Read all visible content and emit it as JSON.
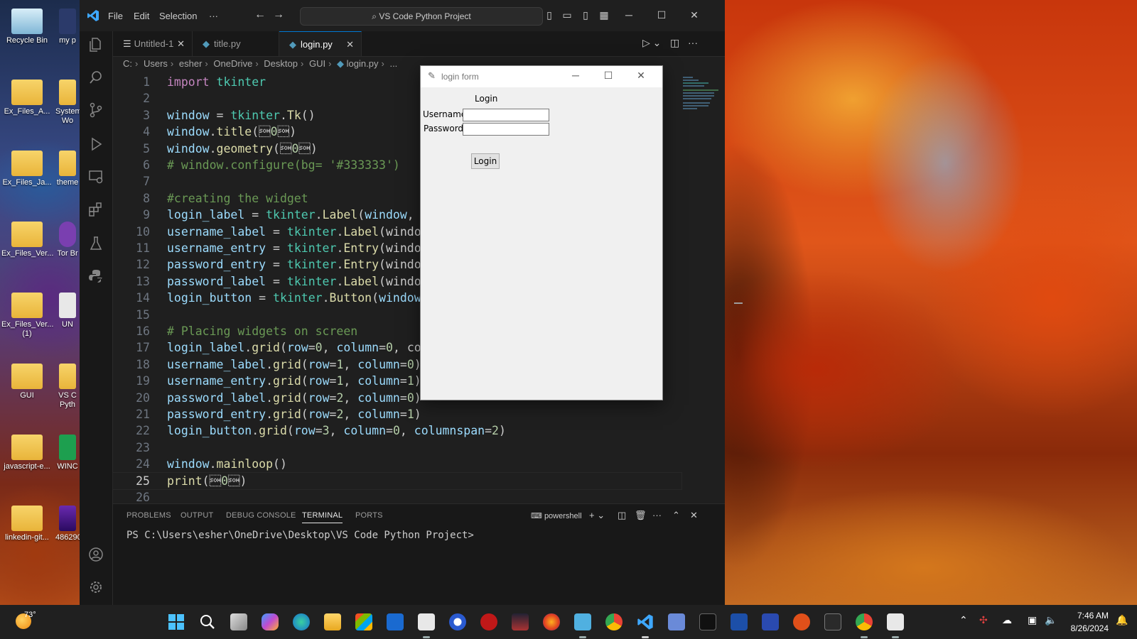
{
  "desktop": {
    "icons": [
      {
        "label": "Recycle Bin"
      },
      {
        "label": "my p"
      },
      {
        "label": "Ex_Files_A..."
      },
      {
        "label": "System Wo"
      },
      {
        "label": "Ex_Files_Ja..."
      },
      {
        "label": "theme"
      },
      {
        "label": "Ex_Files_Ver..."
      },
      {
        "label": "Tor Br"
      },
      {
        "label": "Ex_Files_Ver... (1)"
      },
      {
        "label": "UN"
      },
      {
        "label": "GUI"
      },
      {
        "label": "VS C Pyth"
      },
      {
        "label": "javascript-e..."
      },
      {
        "label": "WINC"
      },
      {
        "label": "linkedin-git..."
      },
      {
        "label": "486290"
      }
    ]
  },
  "vscode": {
    "menu": [
      "File",
      "Edit",
      "Selection",
      "···"
    ],
    "command_center": "VS Code Python Project",
    "tabs": [
      {
        "label": "Untitled-1"
      },
      {
        "label": "title.py"
      },
      {
        "label": "login.py"
      }
    ],
    "breadcrumb": [
      "C:",
      "Users",
      "esher",
      "OneDrive",
      "Desktop",
      "GUI",
      "login.py",
      "..."
    ],
    "current_line": 25,
    "code": [
      {
        "n": "1",
        "text": "import tkinter"
      },
      {
        "n": "2",
        "text": ""
      },
      {
        "n": "3",
        "text": "window = tkinter.Tk()"
      },
      {
        "n": "4",
        "text": "window.title(\"login form\")"
      },
      {
        "n": "5",
        "text": "window.geometry('340x440')"
      },
      {
        "n": "6",
        "text": "# window.configure(bg= '#333333')"
      },
      {
        "n": "7",
        "text": ""
      },
      {
        "n": "8",
        "text": "#creating the widget"
      },
      {
        "n": "9",
        "text": "login_label = tkinter.Label(window,"
      },
      {
        "n": "10",
        "text": "username_label = tkinter.Label(windo"
      },
      {
        "n": "11",
        "text": "username_entry = tkinter.Entry(windo"
      },
      {
        "n": "12",
        "text": "password_entry = tkinter.Entry(windo"
      },
      {
        "n": "13",
        "text": "password_label = tkinter.Label(windo"
      },
      {
        "n": "14",
        "text": "login_button = tkinter.Button(window"
      },
      {
        "n": "15",
        "text": ""
      },
      {
        "n": "16",
        "text": "# Placing widgets on screen"
      },
      {
        "n": "17",
        "text": "login_label.grid(row=0, column=0, co"
      },
      {
        "n": "18",
        "text": "username_label.grid(row=1, column=0)"
      },
      {
        "n": "19",
        "text": "username_entry.grid(row=1, column=1)"
      },
      {
        "n": "20",
        "text": "password_label.grid(row=2, column=0)"
      },
      {
        "n": "21",
        "text": "password_entry.grid(row=2, column=1)"
      },
      {
        "n": "22",
        "text": "login_button.grid(row=3, column=0, columnspan=2)"
      },
      {
        "n": "23",
        "text": ""
      },
      {
        "n": "24",
        "text": "window.mainloop()"
      },
      {
        "n": "25",
        "text": "print(\"hi\")"
      },
      {
        "n": "26",
        "text": ""
      }
    ],
    "panel": {
      "tabs": [
        "PROBLEMS",
        "OUTPUT",
        "DEBUG CONSOLE",
        "TERMINAL",
        "PORTS"
      ],
      "active_tab": "TERMINAL",
      "shell": "powershell",
      "prompt": "PS C:\\Users\\esher\\OneDrive\\Desktop\\VS Code Python Project>"
    }
  },
  "tk_window": {
    "title": "login form",
    "heading": "Login",
    "username_label": "Username",
    "password_label": "Password",
    "button": "Login"
  },
  "taskbar": {
    "temperature": "73°",
    "time": "7:46 AM",
    "date": "8/26/2024"
  },
  "colors": {
    "accent": "#0078d4",
    "keyword": "#c586c0",
    "module": "#4ec9b0",
    "variable": "#9cdcfe",
    "string": "#ce9178",
    "comment": "#6a9955"
  }
}
